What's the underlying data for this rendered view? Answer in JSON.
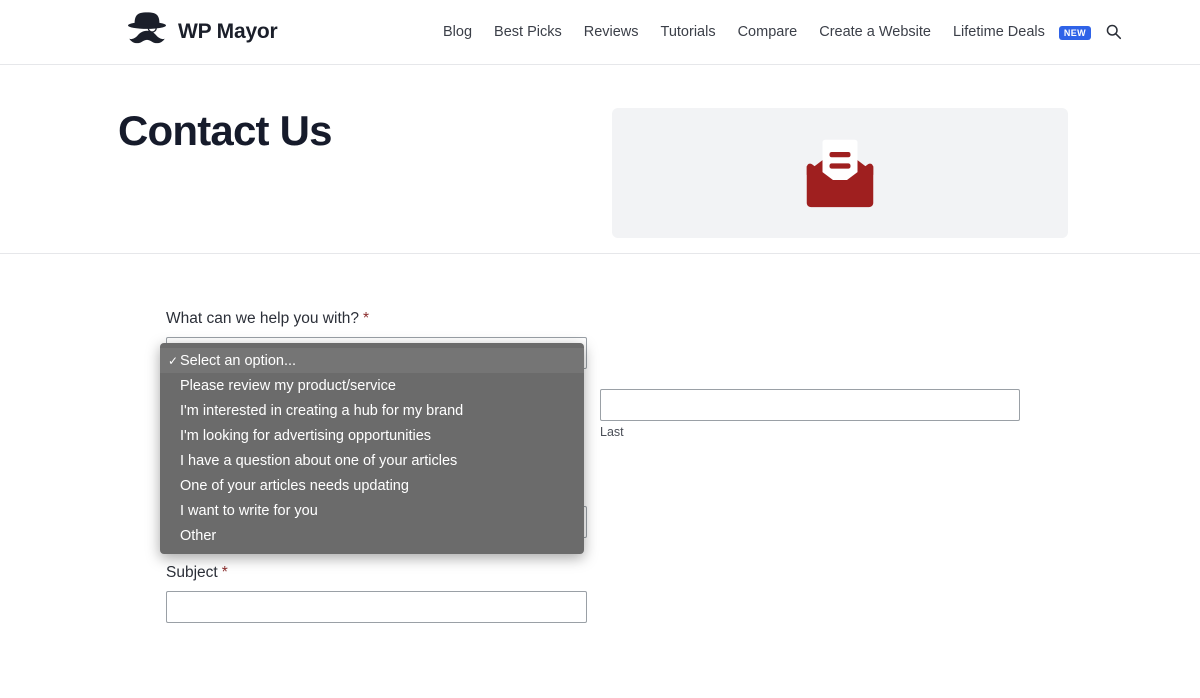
{
  "header": {
    "brand": {
      "name": "WP Mayor",
      "logo_icon": "mustache-tophat-logo-icon"
    },
    "nav": [
      {
        "label": "Blog",
        "badge": null
      },
      {
        "label": "Best Picks",
        "badge": null
      },
      {
        "label": "Reviews",
        "badge": null
      },
      {
        "label": "Tutorials",
        "badge": null
      },
      {
        "label": "Compare",
        "badge": null
      },
      {
        "label": "Create a Website",
        "badge": null
      },
      {
        "label": "Lifetime Deals",
        "badge": "NEW"
      }
    ],
    "search_icon": "search-icon",
    "badge_color": "#2f63e8"
  },
  "hero": {
    "title": "Contact Us",
    "panel_icon": "open-envelope-letter-icon",
    "panel_bg": "#f2f3f5",
    "icon_color": "#a02020"
  },
  "form": {
    "help_field": {
      "label": "What can we help you with?",
      "required_marker": "*",
      "value": "Select an option...",
      "arrow_icon": "chevron-down-icon"
    },
    "name_last": {
      "value": "",
      "sub_label": "Last"
    },
    "hidden_field": {
      "value": ""
    },
    "subject_field": {
      "label": "Subject",
      "required_marker": "*",
      "value": ""
    }
  },
  "dropdown": {
    "open": true,
    "checkmark": "✓",
    "options": [
      {
        "label": "Select an option...",
        "selected": true
      },
      {
        "label": "Please review my product/service",
        "selected": false
      },
      {
        "label": "I'm interested in creating a hub for my brand",
        "selected": false
      },
      {
        "label": "I'm looking for advertising opportunities",
        "selected": false
      },
      {
        "label": "I have a question about one of your articles",
        "selected": false
      },
      {
        "label": "One of your articles needs updating",
        "selected": false
      },
      {
        "label": "I want to write for you",
        "selected": false
      },
      {
        "label": "Other",
        "selected": false
      }
    ]
  }
}
